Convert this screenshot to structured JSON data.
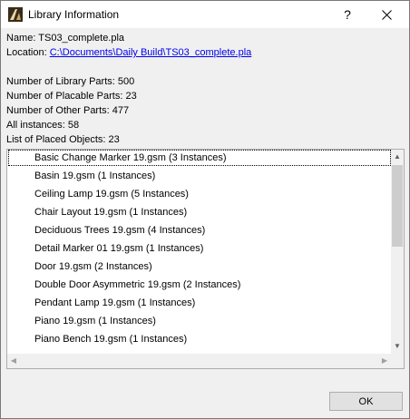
{
  "window": {
    "title": "Library Information",
    "help_glyph": "?",
    "close_icon": "close-icon",
    "app_icon": "archicad-icon"
  },
  "info": {
    "name_label": "Name:",
    "name_value": "TS03_complete.pla",
    "location_label": "Location:",
    "location_value": "C:\\Documents\\Daily Build\\TS03_complete.pla",
    "library_parts": "Number of Library Parts: 500",
    "placable_parts": "Number of Placable Parts: 23",
    "other_parts": "Number of Other Parts: 477",
    "all_instances": "All instances: 58",
    "placed_objects": "List of Placed Objects: 23"
  },
  "list": {
    "items": [
      "Basic Change Marker 19.gsm (3 Instances)",
      "Basin 19.gsm (1 Instances)",
      "Ceiling Lamp 19.gsm (5 Instances)",
      "Chair Layout 19.gsm (1 Instances)",
      "Deciduous Trees 19.gsm (4 Instances)",
      "Detail Marker 01 19.gsm (1 Instances)",
      "Door 19.gsm (2 Instances)",
      "Double Door Asymmetric 19.gsm (2 Instances)",
      "Pendant Lamp 19.gsm (1 Instances)",
      "Piano 19.gsm (1 Instances)",
      "Piano Bench 19.gsm (1 Instances)"
    ]
  },
  "buttons": {
    "ok_label": "OK"
  }
}
